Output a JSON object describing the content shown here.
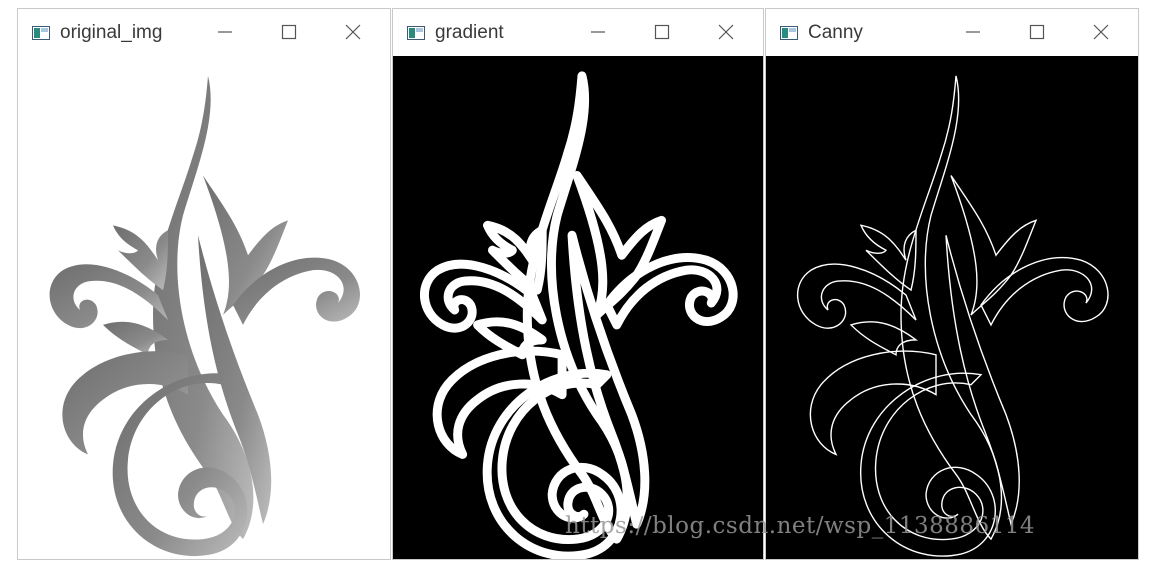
{
  "windows": [
    {
      "title": "original_img"
    },
    {
      "title": "gradient"
    },
    {
      "title": "Canny"
    }
  ],
  "watermark": "https://blog.csdn.net/wsp_1138886114",
  "colors": {
    "icon_teal": "#2a8c7e",
    "canvas_dark": "#000000",
    "shape_gray": "#7a7a7a"
  }
}
